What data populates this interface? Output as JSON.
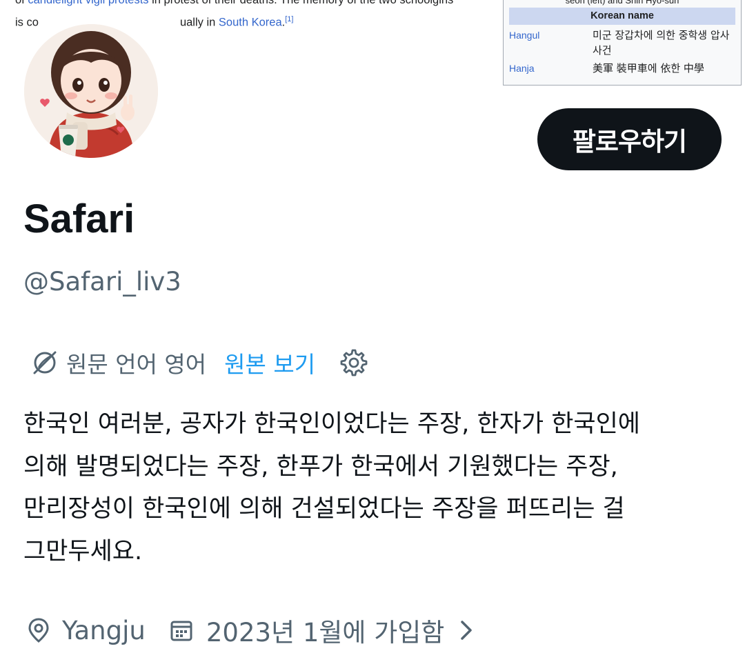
{
  "banner": {
    "line1_pre": "of ",
    "line1_link1": "candlelight vigil protests",
    "line1_post": " in protest of their deaths. The memory of the two schoolgirls",
    "line2_pre": "is co",
    "line2_mid": "ually in ",
    "line2_link": "South Korea",
    "line2_post": ".",
    "line2_ref": "[1]",
    "infobox": {
      "caption": "seon (left) and Shin Hyo-sun",
      "header": "Korean name",
      "rows": [
        {
          "label": "Hangul",
          "value": "미군 장갑차에 의한 중학생 압사 사건"
        },
        {
          "label": "Hanja",
          "value": "美軍 裝甲車에 依한 中學"
        }
      ]
    }
  },
  "avatar": {
    "icon": "avatar-girl-with-coffee"
  },
  "follow_button": {
    "label": "팔로우하기"
  },
  "profile": {
    "display_name": "Safari",
    "handle": "@Safari_liv3",
    "translation": {
      "source_lang": "원문 언어 영어",
      "view_original": "원본 보기"
    },
    "bio": "한국인 여러분, 공자가 한국인이었다는 주장, 한자가 한국인에\n의해 발명되었다는 주장, 한푸가 한국에서 기원했다는 주장,\n만리장성이 한국인에 의해 건설되었다는 주장을 퍼뜨리는 걸\n그만두세요.",
    "location": "Yangju",
    "joined": "2023년 1월에 가입함"
  },
  "colors": {
    "text_primary": "#0f1419",
    "text_secondary": "#536471",
    "link": "#1d9bf0",
    "button_bg": "#0f1419",
    "wiki_link": "#3366cc"
  }
}
